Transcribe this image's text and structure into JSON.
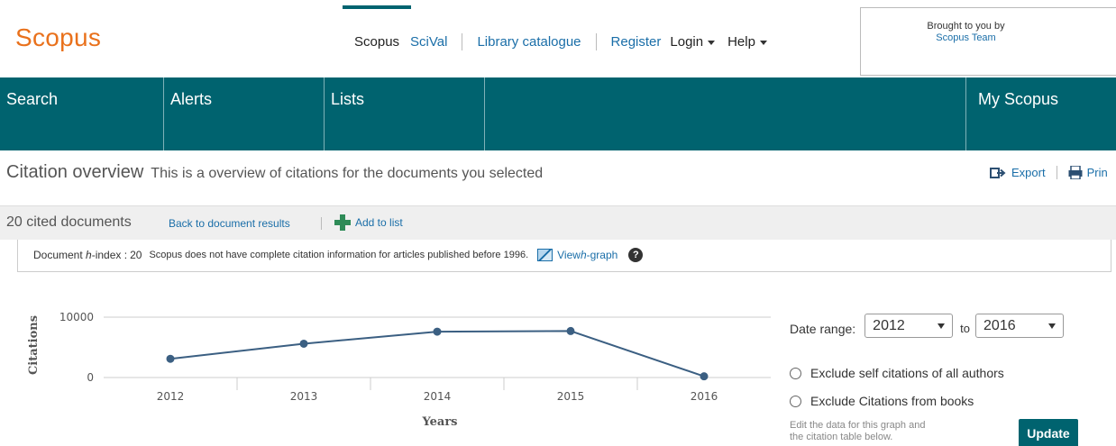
{
  "brand": {
    "logo": "Scopus"
  },
  "top_nav": {
    "scopus": "Scopus",
    "scival": "SciVal",
    "library": "Library catalogue",
    "register": "Register",
    "login": "Login",
    "help": "Help"
  },
  "brought": {
    "line1": "Brought to you by",
    "line2": "Scopus Team"
  },
  "main_nav": {
    "search": "Search",
    "alerts": "Alerts",
    "lists": "Lists",
    "my_scopus": "My Scopus"
  },
  "overview": {
    "title": "Citation overview",
    "subtitle": "This is a overview of citations for the documents you selected",
    "export": "Export",
    "print": "Prin"
  },
  "cited": {
    "count_text": "20 cited documents",
    "back": "Back to document results",
    "add": "Add to list"
  },
  "hindex": {
    "label_prefix": "Document ",
    "label_h": "h",
    "label_suffix": "-index :",
    "value": "20",
    "note": "Scopus does not have complete citation information for articles published before 1996.",
    "view_prefix": "View ",
    "view_h": "h",
    "view_suffix": "-graph",
    "help": "?"
  },
  "chart_data": {
    "type": "line",
    "ylabel": "Citations",
    "xlabel": "Years",
    "y_ticks": [
      "0",
      "10000"
    ],
    "ylim": [
      0,
      10000
    ],
    "categories": [
      "2012",
      "2013",
      "2014",
      "2015",
      "2016"
    ],
    "series": [
      {
        "values": [
          3100,
          5600,
          7600,
          7700,
          200
        ]
      }
    ],
    "grid": false,
    "color": "#3b5f82"
  },
  "controls": {
    "date_label": "Date range:",
    "from_year": "2012",
    "to_label": "to",
    "to_year": "2016",
    "exclude_self": "Exclude self citations of all authors",
    "exclude_books": "Exclude Citations from books",
    "edit_line1": "Edit the data for this graph and",
    "edit_line2": "the citation table below.",
    "update": "Update"
  }
}
